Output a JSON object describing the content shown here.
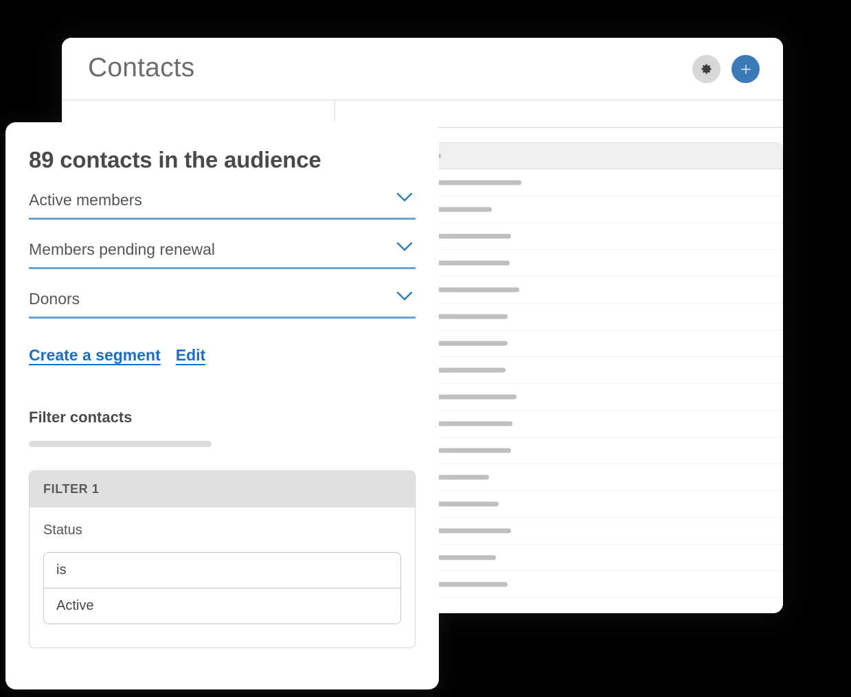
{
  "window": {
    "title": "Contacts",
    "header_actions": [
      {
        "name": "settings-button",
        "icon": "gear-icon"
      },
      {
        "name": "add-contact-button",
        "icon": "plus-icon"
      }
    ]
  },
  "colors": {
    "accent_blue": "#3a7ab8",
    "link_blue": "#1b6ec2",
    "underline_blue": "#6ba3d6",
    "gear_button_bg": "#d8d8d8",
    "skeleton_bar": "#bfbfbf",
    "table_header_bg": "#efefef",
    "filter_header_bg": "#e0e0e0",
    "page_bg": "#000000"
  },
  "table": {
    "is_skeleton": true,
    "header_bars": [
      56,
      100,
      60,
      58
    ],
    "row_bars": [
      [
        100,
        18,
        40,
        175
      ],
      [
        110,
        18,
        40,
        132
      ],
      [
        124,
        18,
        40,
        160
      ],
      [
        118,
        18,
        40,
        158
      ],
      [
        112,
        18,
        40,
        172
      ],
      [
        122,
        18,
        40,
        155
      ],
      [
        108,
        18,
        40,
        155
      ],
      [
        118,
        18,
        40,
        152
      ],
      [
        106,
        18,
        40,
        168
      ],
      [
        120,
        18,
        40,
        162
      ],
      [
        100,
        18,
        40,
        160
      ],
      [
        105,
        18,
        40,
        128
      ],
      [
        112,
        18,
        40,
        142
      ],
      [
        108,
        18,
        40,
        160
      ],
      [
        110,
        18,
        40,
        138
      ],
      [
        100,
        18,
        40,
        155
      ]
    ]
  },
  "dialog": {
    "heading": "89 contacts in the audience",
    "selects": [
      {
        "label": "Active members",
        "icon": "chevron-down-icon"
      },
      {
        "label": "Members pending renewal",
        "icon": "chevron-down-icon"
      },
      {
        "label": "Donors",
        "icon": "chevron-down-icon"
      }
    ],
    "links": [
      {
        "label": "Create a segment"
      },
      {
        "label": "Edit"
      }
    ],
    "filter_section": {
      "title": "Filter contacts",
      "has_placeholder_bar": true,
      "filter_card": {
        "header": "FILTER 1",
        "field_label": "Status",
        "combo": [
          {
            "value": "is"
          },
          {
            "value": "Active"
          }
        ]
      }
    }
  }
}
